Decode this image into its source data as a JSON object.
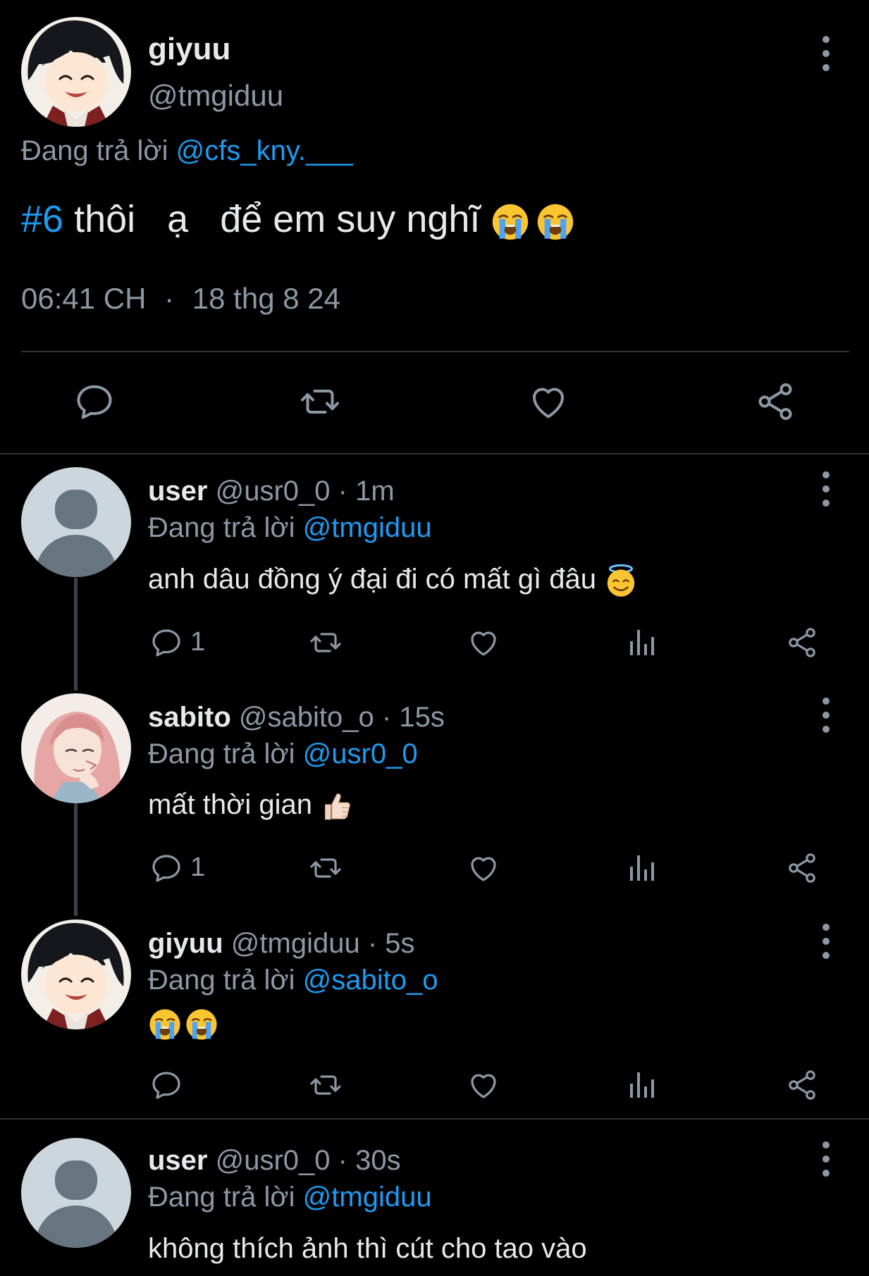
{
  "main_tweet": {
    "name": "giyuu",
    "handle": "@tmgiduu",
    "replying_prefix": "Đang trả lời",
    "replying_to": "@cfs_kny.___",
    "hashtag": "#6",
    "text": " thôi   ạ   để em suy nghĩ ",
    "emojis": [
      "loudly-crying-face",
      "loudly-crying-face"
    ],
    "time": "06:41 CH",
    "separator": "·",
    "date": "18 thg 8 24",
    "actions": [
      "reply-icon",
      "retweet-icon",
      "like-icon",
      "share-icon"
    ]
  },
  "replies": [
    {
      "name": "user",
      "handle": "@usr0_0",
      "age": "· 1m",
      "replying_prefix": "Đang trả lời",
      "replying_to": "@tmgiduu",
      "text": "anh dâu đồng ý đại đi có mất gì đâu ",
      "emoji": "smiling-face-with-halo",
      "reply_count": "1",
      "avatar": "default-avatar"
    },
    {
      "name": "sabito",
      "handle": "@sabito_o",
      "age": "· 15s",
      "replying_prefix": "Đang trả lời",
      "replying_to": "@usr0_0",
      "text": "mất thời gian ",
      "emoji": "thumbs-up",
      "reply_count": "1",
      "avatar": "sabito-avatar"
    },
    {
      "name": "giyuu",
      "handle": "@tmgiduu",
      "age": "· 5s",
      "replying_prefix": "Đang trả lời",
      "replying_to": "@sabito_o",
      "text": "",
      "emoji": "loudly-crying-face x2",
      "reply_count": "",
      "avatar": "giyuu-avatar"
    },
    {
      "name": "user",
      "handle": "@usr0_0",
      "age": "· 30s",
      "replying_prefix": "Đang trả lời",
      "replying_to": "@tmgiduu",
      "text": "không thích ảnh thì cút cho tao vào",
      "avatar": "default-avatar"
    }
  ],
  "colors": {
    "background": "#000000",
    "text": "#e7e9ea",
    "muted": "#8b98a5",
    "link": "#1d9bf0",
    "divider": "#2f3336"
  }
}
